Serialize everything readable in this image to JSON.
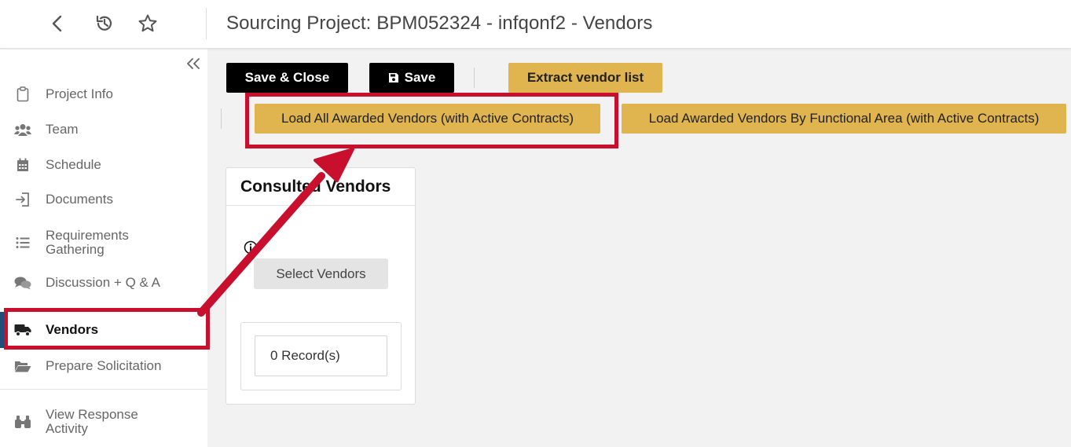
{
  "header": {
    "title": "Sourcing Project: BPM052324 - infqonf2 - Vendors",
    "icons": [
      "back-icon",
      "history-icon",
      "star-icon"
    ]
  },
  "sidebar": {
    "items": [
      {
        "label": "Project Info",
        "icon": "clipboard-icon"
      },
      {
        "label": "Team",
        "icon": "users-icon"
      },
      {
        "label": "Schedule",
        "icon": "calendar-icon"
      },
      {
        "label": "Documents",
        "icon": "sign-in-icon"
      },
      {
        "label": "Requirements Gathering",
        "icon": "list-icon"
      },
      {
        "label": "Discussion + Q & A",
        "icon": "comments-icon"
      },
      {
        "label": "Vendors",
        "icon": "truck-icon",
        "active": true
      },
      {
        "label": "Prepare Solicitation",
        "icon": "folder-open-icon"
      },
      {
        "label": "View Response Activity",
        "icon": "binoculars-icon"
      }
    ]
  },
  "toolbar": {
    "save_close": "Save & Close",
    "save": "Save",
    "extract": "Extract vendor list",
    "load_all": "Load All Awarded Vendors (with Active Contracts)",
    "load_by_area": "Load Awarded Vendors By Functional Area (with Active Contracts)"
  },
  "card": {
    "title": "Consulted Vendors",
    "select_button": "Select Vendors",
    "records": "0 Record(s)"
  },
  "colors": {
    "accent_gold": "#e0b44e",
    "annotation_red": "#c8102e",
    "active_bar": "#1f4e79"
  }
}
